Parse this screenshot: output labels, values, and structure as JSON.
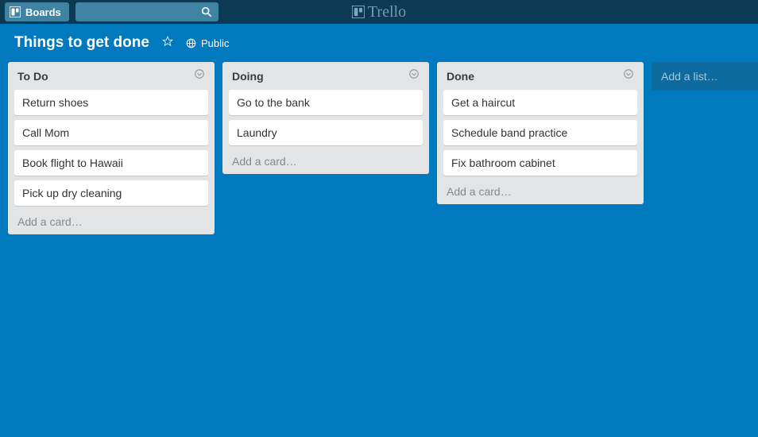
{
  "brand": "Trello",
  "topbar": {
    "boards_label": "Boards"
  },
  "board": {
    "title": "Things to get done",
    "visibility": "Public"
  },
  "lists": [
    {
      "title": "To Do",
      "cards": [
        "Return shoes",
        "Call Mom",
        "Book flight to Hawaii",
        "Pick up dry cleaning"
      ],
      "add_card": "Add a card…"
    },
    {
      "title": "Doing",
      "cards": [
        "Go to the bank",
        "Laundry"
      ],
      "add_card": "Add a card…"
    },
    {
      "title": "Done",
      "cards": [
        "Get a haircut",
        "Schedule band practice",
        "Fix bathroom cabinet"
      ],
      "add_card": "Add a card…"
    }
  ],
  "add_list": "Add a list…"
}
